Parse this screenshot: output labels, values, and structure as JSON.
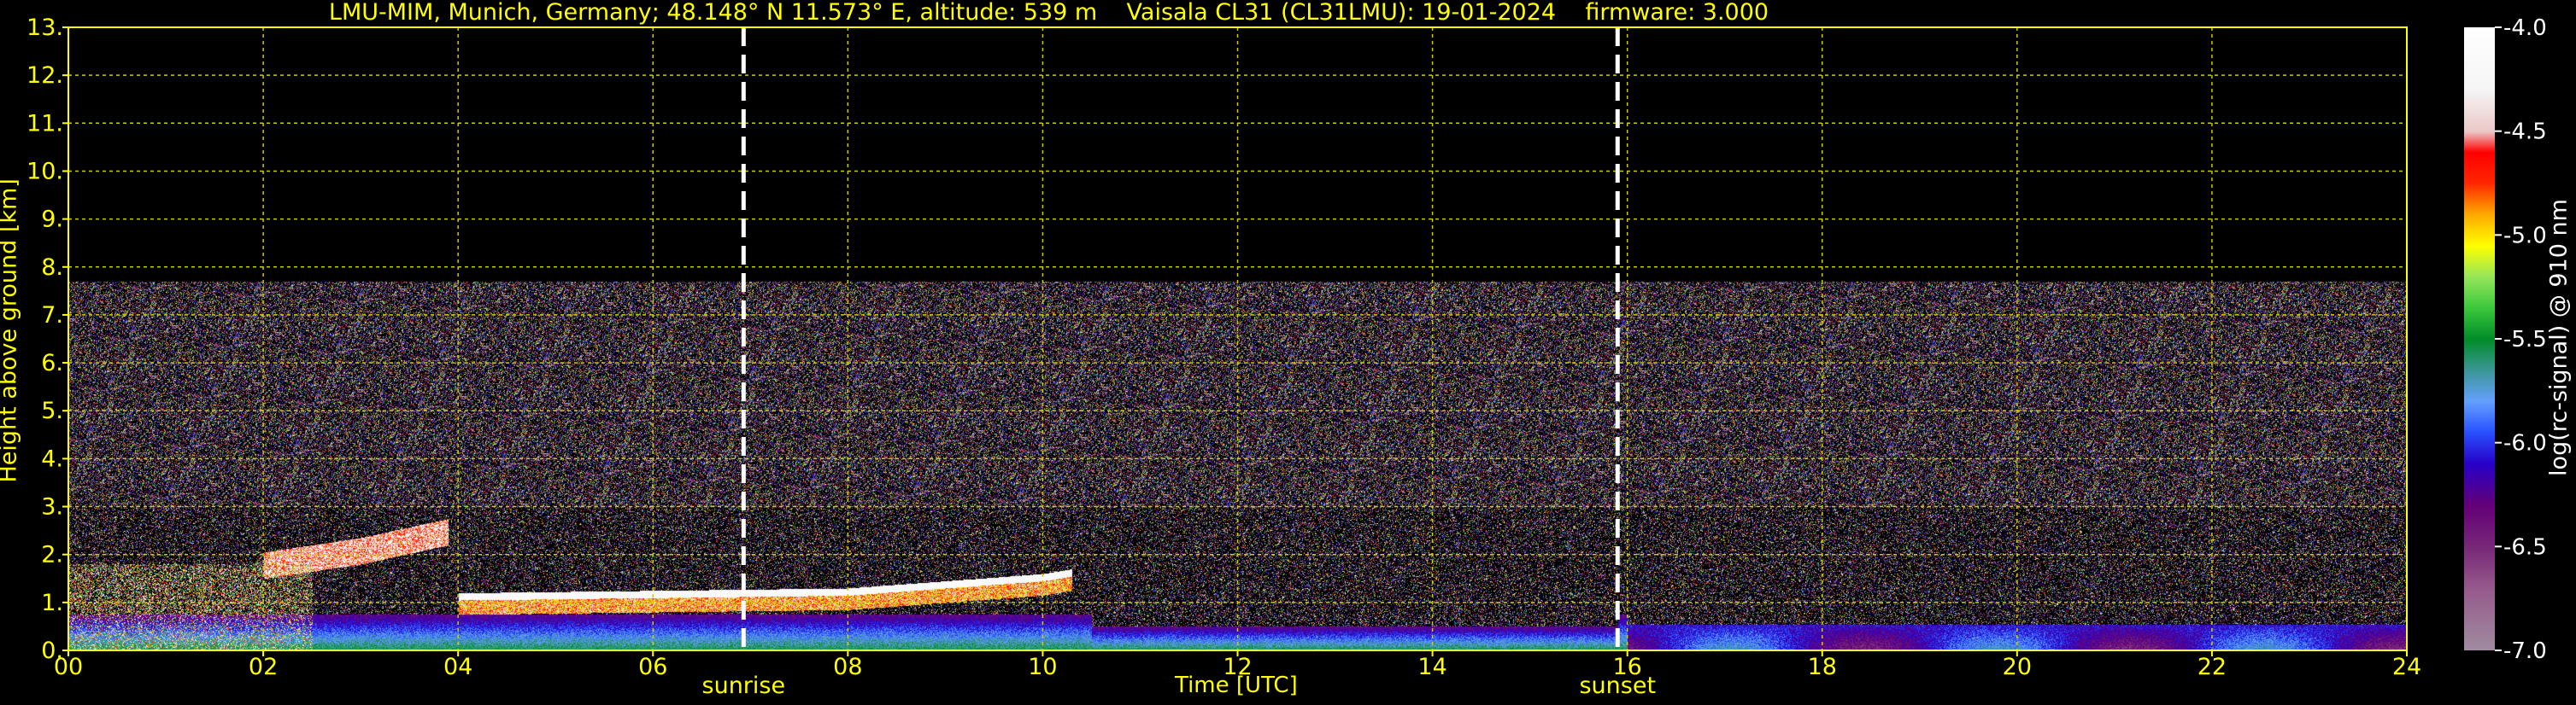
{
  "title": {
    "site": "LMU-MIM, Munich, Germany; 48.148° N 11.573° E, altitude: 539 m",
    "instrument": "Vaisala CL31 (CL31LMU): 19-01-2024",
    "firmware": "firmware: 3.000"
  },
  "chart_data": {
    "type": "heatmap",
    "xlabel": "Time [UTC]",
    "ylabel": "Height above ground [km]",
    "xlim": [
      0,
      24
    ],
    "ylim": [
      0,
      13
    ],
    "x_ticks": [
      "00",
      "02",
      "04",
      "06",
      "08",
      "10",
      "12",
      "14",
      "16",
      "18",
      "20",
      "22",
      "24"
    ],
    "y_ticks": [
      "0.",
      "1.",
      "2.",
      "3.",
      "4.",
      "5.",
      "6.",
      "7.",
      "8.",
      "9.",
      "10.",
      "11.",
      "12.",
      "13."
    ],
    "grid": true,
    "colorbar": {
      "label": "log(rc-signal) @ 910 nm",
      "range": [
        -7.0,
        -4.0
      ],
      "ticks": [
        "-4.0",
        "-4.5",
        "-5.0",
        "-5.5",
        "-6.0",
        "-6.5",
        "-7.0"
      ]
    },
    "annotations": [
      {
        "label": "sunrise",
        "x": 6.93
      },
      {
        "label": "sunset",
        "x": 15.9
      }
    ],
    "cloud_layers": [
      {
        "description": "low cloud layer",
        "x": [
          4.0,
          6.0,
          8.0,
          10.0,
          10.3
        ],
        "base": [
          1.1,
          1.15,
          1.2,
          1.5,
          1.6
        ]
      },
      {
        "description": "elevated layer",
        "x": [
          2.0,
          3.0,
          3.9
        ],
        "base": [
          1.7,
          2.0,
          2.4
        ]
      }
    ],
    "noise_top_km": 7.7,
    "boundary_layer_top_km": 1.0
  }
}
